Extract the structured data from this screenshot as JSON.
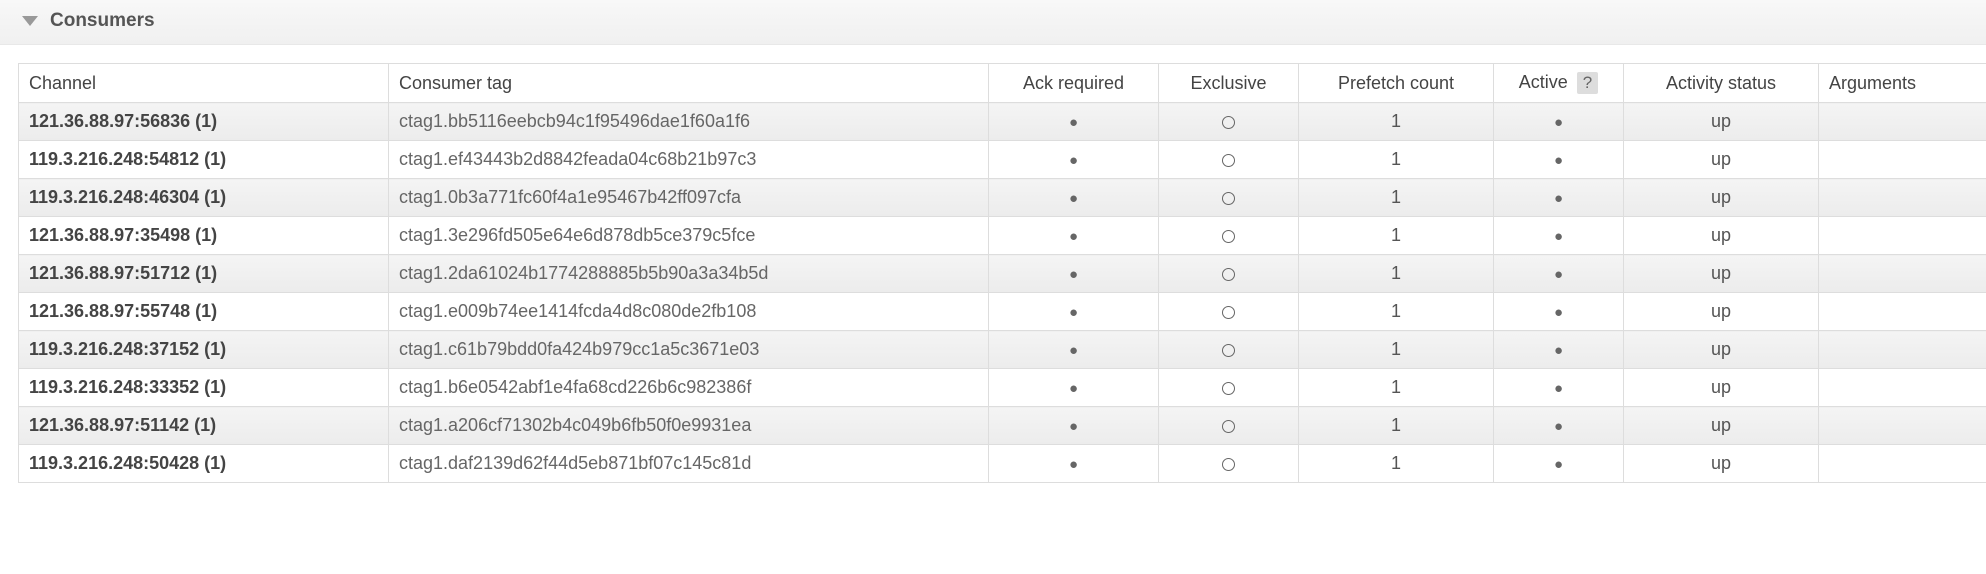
{
  "section": {
    "title": "Consumers"
  },
  "headers": {
    "channel": "Channel",
    "consumer_tag": "Consumer tag",
    "ack_required": "Ack required",
    "exclusive": "Exclusive",
    "prefetch_count": "Prefetch count",
    "active": "Active",
    "active_help": "?",
    "activity_status": "Activity status",
    "arguments": "Arguments"
  },
  "rows": [
    {
      "channel": "121.36.88.97:56836 (1)",
      "tag": "ctag1.bb5116eebcb94c1f95496dae1f60a1f6",
      "ack": true,
      "exclusive": false,
      "prefetch": "1",
      "active": true,
      "activity": "up",
      "args": ""
    },
    {
      "channel": "119.3.216.248:54812 (1)",
      "tag": "ctag1.ef43443b2d8842feada04c68b21b97c3",
      "ack": true,
      "exclusive": false,
      "prefetch": "1",
      "active": true,
      "activity": "up",
      "args": ""
    },
    {
      "channel": "119.3.216.248:46304 (1)",
      "tag": "ctag1.0b3a771fc60f4a1e95467b42ff097cfa",
      "ack": true,
      "exclusive": false,
      "prefetch": "1",
      "active": true,
      "activity": "up",
      "args": ""
    },
    {
      "channel": "121.36.88.97:35498 (1)",
      "tag": "ctag1.3e296fd505e64e6d878db5ce379c5fce",
      "ack": true,
      "exclusive": false,
      "prefetch": "1",
      "active": true,
      "activity": "up",
      "args": ""
    },
    {
      "channel": "121.36.88.97:51712 (1)",
      "tag": "ctag1.2da61024b1774288885b5b90a3a34b5d",
      "ack": true,
      "exclusive": false,
      "prefetch": "1",
      "active": true,
      "activity": "up",
      "args": ""
    },
    {
      "channel": "121.36.88.97:55748 (1)",
      "tag": "ctag1.e009b74ee1414fcda4d8c080de2fb108",
      "ack": true,
      "exclusive": false,
      "prefetch": "1",
      "active": true,
      "activity": "up",
      "args": ""
    },
    {
      "channel": "119.3.216.248:37152 (1)",
      "tag": "ctag1.c61b79bdd0fa424b979cc1a5c3671e03",
      "ack": true,
      "exclusive": false,
      "prefetch": "1",
      "active": true,
      "activity": "up",
      "args": ""
    },
    {
      "channel": "119.3.216.248:33352 (1)",
      "tag": "ctag1.b6e0542abf1e4fa68cd226b6c982386f",
      "ack": true,
      "exclusive": false,
      "prefetch": "1",
      "active": true,
      "activity": "up",
      "args": ""
    },
    {
      "channel": "121.36.88.97:51142 (1)",
      "tag": "ctag1.a206cf71302b4c049b6fb50f0e9931ea",
      "ack": true,
      "exclusive": false,
      "prefetch": "1",
      "active": true,
      "activity": "up",
      "args": ""
    },
    {
      "channel": "119.3.216.248:50428 (1)",
      "tag": "ctag1.daf2139d62f44d5eb871bf07c145c81d",
      "ack": true,
      "exclusive": false,
      "prefetch": "1",
      "active": true,
      "activity": "up",
      "args": ""
    }
  ]
}
